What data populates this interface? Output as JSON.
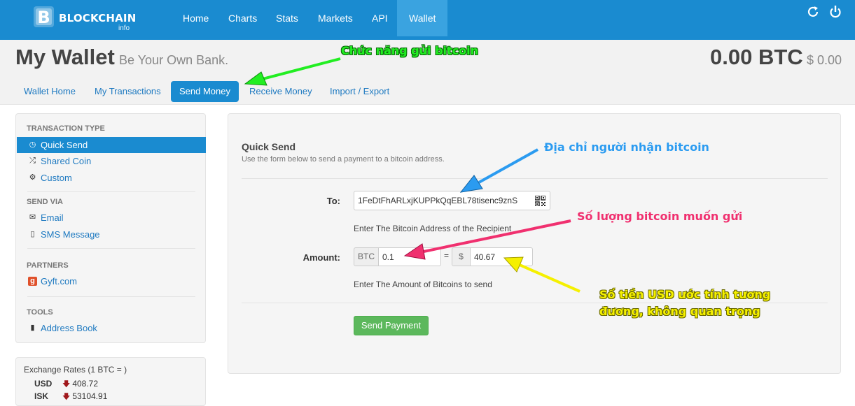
{
  "brand": {
    "name": "BLOCKCHAIN",
    "sub": "info"
  },
  "nav": {
    "items": [
      "Home",
      "Charts",
      "Stats",
      "Markets",
      "API",
      "Wallet"
    ]
  },
  "header": {
    "title": "My Wallet",
    "subtitle": "Be Your Own Bank.",
    "balance": "0.00 BTC",
    "balance_usd": "$ 0.00"
  },
  "tabs": [
    "Wallet Home",
    "My Transactions",
    "Send Money",
    "Receive Money",
    "Import / Export"
  ],
  "sidebar": {
    "transaction_type": {
      "heading": "TRANSACTION TYPE",
      "items": [
        "Quick Send",
        "Shared Coin",
        "Custom"
      ]
    },
    "send_via": {
      "heading": "SEND VIA",
      "items": [
        "Email",
        "SMS Message"
      ]
    },
    "partners": {
      "heading": "PARTNERS",
      "items": [
        "Gyft.com"
      ]
    },
    "tools": {
      "heading": "TOOLS",
      "items": [
        "Address Book"
      ]
    }
  },
  "rates": {
    "title": "Exchange Rates (1 BTC = )",
    "rows": [
      {
        "code": "USD",
        "value": "408.72"
      },
      {
        "code": "ISK",
        "value": "53104.91"
      }
    ]
  },
  "form": {
    "title": "Quick Send",
    "description": "Use the form below to send a payment to a bitcoin address.",
    "to_label": "To:",
    "to_value": "1FeDtFhARLxjKUPPkQqEBL78tisenc9znS",
    "to_help": "Enter The Bitcoin Address of the Recipient",
    "amount_label": "Amount:",
    "btc_addon": "BTC",
    "btc_value": "0.1",
    "equals": "=",
    "usd_addon": "$",
    "usd_value": "40.67",
    "amount_help": "Enter The Amount of Bitcoins to send",
    "send_button": "Send Payment"
  },
  "annotations": {
    "send_function": "Chức năng gửi bitcoin",
    "recipient_address": "Địa chỉ người nhận bitcoin",
    "amount_to_send": "Số lượng bitcoin muốn gửi",
    "usd_estimate_line1": "Số tiền USD ước tính tương",
    "usd_estimate_line2": "đương, không quan trọng"
  },
  "colors": {
    "brand_blue": "#1a8bd0",
    "green_note": "#22ee22",
    "blue_note": "#2b9bf0",
    "pink_note": "#f0306f",
    "yellow_note": "#f5f000"
  }
}
